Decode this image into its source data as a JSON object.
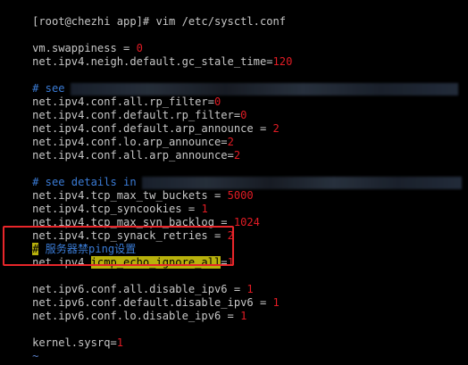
{
  "terminal": {
    "prompt": "[root@chezhi app]# vim /etc/sysctl.conf",
    "lines": {
      "swappiness": {
        "key": "vm.swappiness = ",
        "value": "0"
      },
      "gc_stale": {
        "key": "net.ipv4.neigh.default.gc_stale_time=",
        "value": "120"
      },
      "comment1": "# see",
      "rp_filter_all": {
        "key": "net.ipv4.conf.all.rp_filter=",
        "value": "0"
      },
      "rp_filter_default": {
        "key": "net.ipv4.conf.default.rp_filter=",
        "value": "0"
      },
      "arp_default": {
        "key": "net.ipv4.conf.default.arp_announce = ",
        "value": "2"
      },
      "arp_lo": {
        "key": "net.ipv4.conf.lo.arp_announce=",
        "value": "2"
      },
      "arp_all": {
        "key": "net.ipv4.conf.all.arp_announce=",
        "value": "2"
      },
      "comment2": "# see details in",
      "tw_buckets": {
        "key": "net.ipv4.tcp_max_tw_buckets = ",
        "value": "5000"
      },
      "syncookies": {
        "key": "net.ipv4.tcp_syncookies = ",
        "value": "1"
      },
      "syn_backlog": {
        "key": "net.ipv4.tcp_max_syn_backlog = ",
        "value": "1024"
      },
      "synack": {
        "key": "net.ipv4.tcp_synack_retries = ",
        "value": "2"
      },
      "comment_ping": {
        "hash": "#",
        "text": " 服务器禁ping设置"
      },
      "icmp": {
        "prefix": "net.ipv4.",
        "highlighted": "icmp_echo_ignore_all",
        "eq": "=",
        "value": "1"
      },
      "ipv6_all": {
        "key": "net.ipv6.conf.all.disable_ipv6 = ",
        "value": "1"
      },
      "ipv6_default": {
        "key": "net.ipv6.conf.default.disable_ipv6 = ",
        "value": "1"
      },
      "ipv6_lo": {
        "key": "net.ipv6.conf.lo.disable_ipv6 = ",
        "value": "1"
      },
      "sysrq": {
        "key": "kernel.sysrq=",
        "value": "1"
      }
    },
    "tilde": "~"
  },
  "colors": {
    "background": "#000000",
    "text": "#c7c7c7",
    "value": "#e01b24",
    "comment": "#3a7bd5",
    "highlight": "#b8b10c",
    "annotation_box": "#e8262a"
  }
}
